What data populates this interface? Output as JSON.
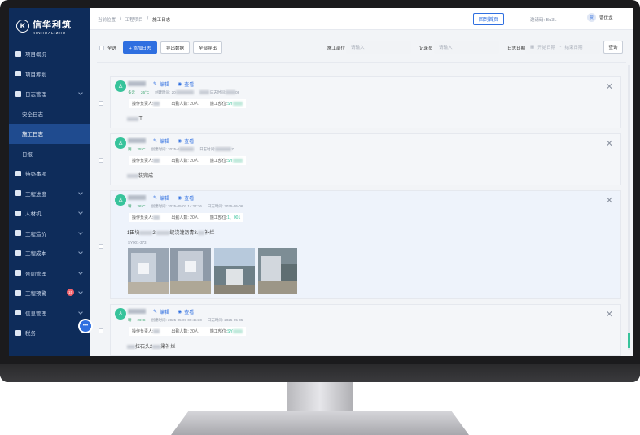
{
  "brand": {
    "name_cn": "信华利筑",
    "name_en": "XINHUALIZHU"
  },
  "sidebar": {
    "items": [
      {
        "label": "项目概况"
      },
      {
        "label": "项目筹划"
      },
      {
        "label": "日志管理"
      },
      {
        "label": "安全日志"
      },
      {
        "label": "施工日志"
      },
      {
        "label": "日报"
      },
      {
        "label": "待办事项"
      },
      {
        "label": "工程进度"
      },
      {
        "label": "人材机"
      },
      {
        "label": "工程造价"
      },
      {
        "label": "工程成本"
      },
      {
        "label": "合同管理"
      },
      {
        "label": "工程预警"
      },
      {
        "label": "信息管理"
      },
      {
        "label": "税务"
      }
    ],
    "warning_badge": "15"
  },
  "header": {
    "breadcrumb": [
      "当前位置",
      "工程项目",
      "施工日志"
    ],
    "home_button": "回到首页",
    "invite_code": "邀请码: Bu3L",
    "user_initial": "贾",
    "user_name": "贾伏龙"
  },
  "toolbar": {
    "select_all": "全选",
    "add_button": "+ 添加日志",
    "export_button": "导出数据",
    "export_all_button": "全部导出",
    "dept_label": "施工部位",
    "dept_placeholder": "请输入",
    "recorder_label": "记录员",
    "recorder_placeholder": "请输入",
    "date_label": "日志日期",
    "start_date": "开始日期",
    "date_sep": "~",
    "end_date": "结束日期",
    "query_button": "查询"
  },
  "cards": [
    {
      "weather": "多云",
      "temp": "26°C",
      "created_label": "创建时间:",
      "created": "20",
      "log_date_label": "日志时间:",
      "log_date": "08",
      "operator_label": "操作负责人:",
      "attendance": "出勤人数: 20人",
      "part_label": "施工部位:",
      "part": "SY",
      "content": "工",
      "edit": "编辑",
      "view": "查看",
      "avatar": "♙",
      "close": "✕"
    },
    {
      "weather": "阴",
      "temp": "25°C",
      "created_label": "创建时间:",
      "created": "2025-0",
      "log_date_label": "日志时间:",
      "log_date": "7",
      "operator_label": "操作负责人:",
      "attendance": "出勤人数: 20人",
      "part_label": "施工部位:",
      "part": "SY",
      "content": "装完成",
      "edit": "编辑",
      "view": "查看",
      "avatar": "♙",
      "close": "✕"
    },
    {
      "weather": "晴",
      "temp": "26°C",
      "created_label": "创建时间:",
      "created": "2025-05-07 14:27:36",
      "log_date_label": "日志时间:",
      "log_date": "2025-05-06",
      "operator_label": "操作负责人:",
      "attendance": "出勤人数: 20人",
      "part_label": "施工部位:",
      "part": "1、001",
      "content_a": "1田块",
      "content_b": "2.",
      "content_c": "缝浇灌沥青3.",
      "content_d": "补烂",
      "code": "SY001-373",
      "edit": "编辑",
      "view": "查看",
      "avatar": "♙",
      "close": "✕"
    },
    {
      "weather": "晴",
      "temp": "26°C",
      "created_label": "创建时间:",
      "created": "2025-05-07 09:45:30",
      "log_date_label": "日志时间:",
      "log_date": "2025-05-05",
      "operator_label": "操作负责人:",
      "attendance": "出勤人数: 20人",
      "part_label": "施工部位:",
      "part": "SY",
      "content_a": "拉石头2",
      "content_b": "梁补烂",
      "edit": "编辑",
      "view": "查看",
      "avatar": "♙",
      "close": "✕"
    }
  ],
  "float_chat": "•••",
  "colors": {
    "sidebar": "#0e2c5a",
    "accent": "#2f6fe0",
    "green": "#37c39b"
  }
}
